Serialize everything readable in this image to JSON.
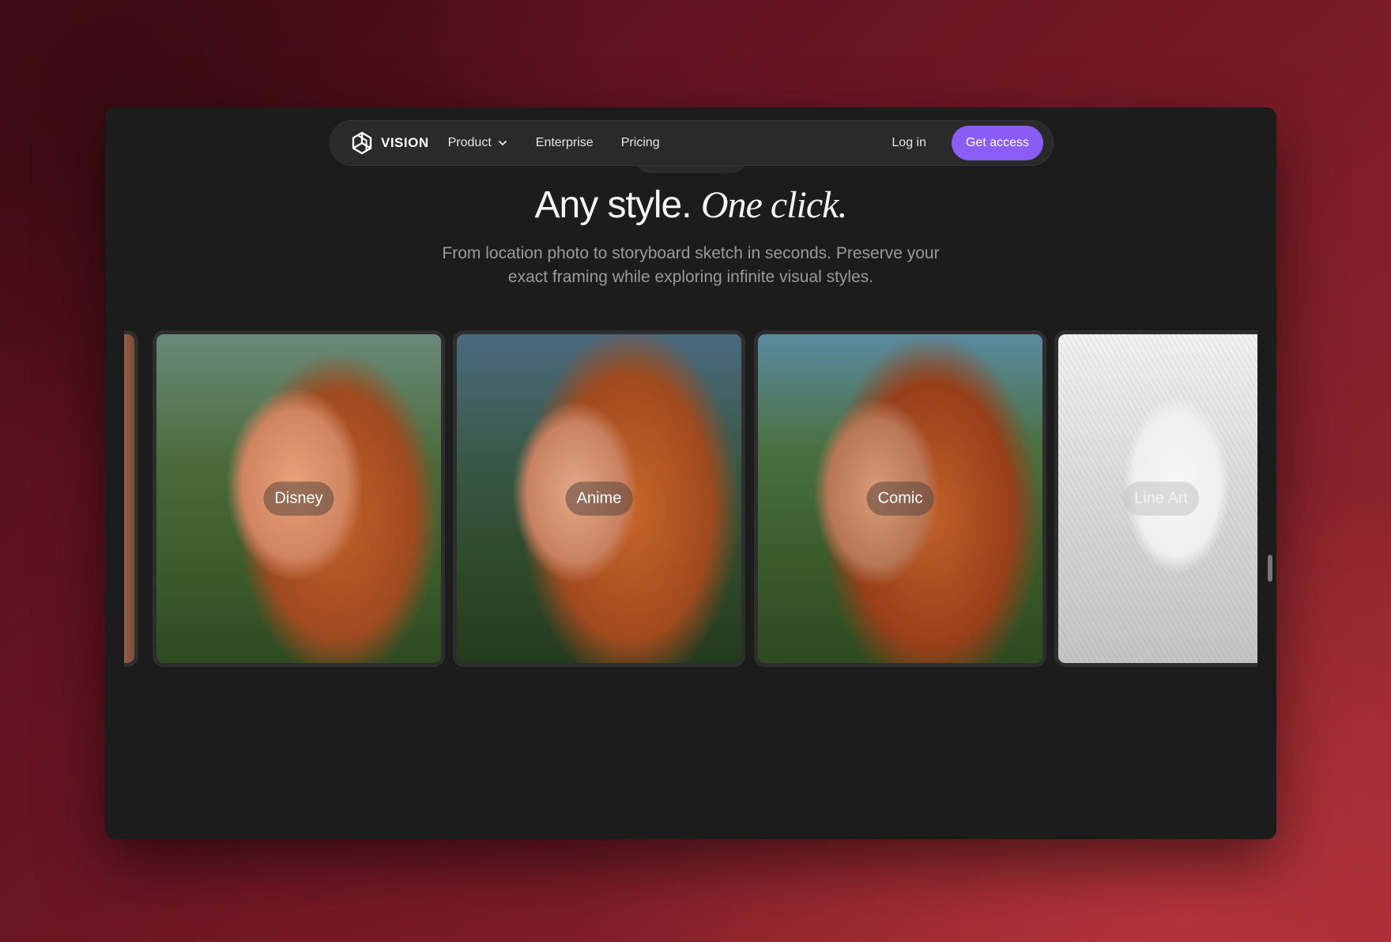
{
  "brand": {
    "name": "VISION",
    "logo_icon": "hexagon-cube-logo"
  },
  "nav": {
    "product": "Product",
    "enterprise": "Enterprise",
    "pricing": "Pricing",
    "login": "Log in",
    "cta": "Get access"
  },
  "hero": {
    "title_plain": "Any style.",
    "title_italic": "One click.",
    "subtitle": "From location photo to storyboard sketch in seconds. Preserve your exact framing while exploring infinite visual styles."
  },
  "styles": [
    {
      "label": "Disney"
    },
    {
      "label": "Anime"
    },
    {
      "label": "Comic"
    },
    {
      "label": "Line Art"
    }
  ],
  "colors": {
    "accent": "#8b5cf6",
    "panel": "#1c1c1c",
    "nav": "#2a2a2a"
  }
}
